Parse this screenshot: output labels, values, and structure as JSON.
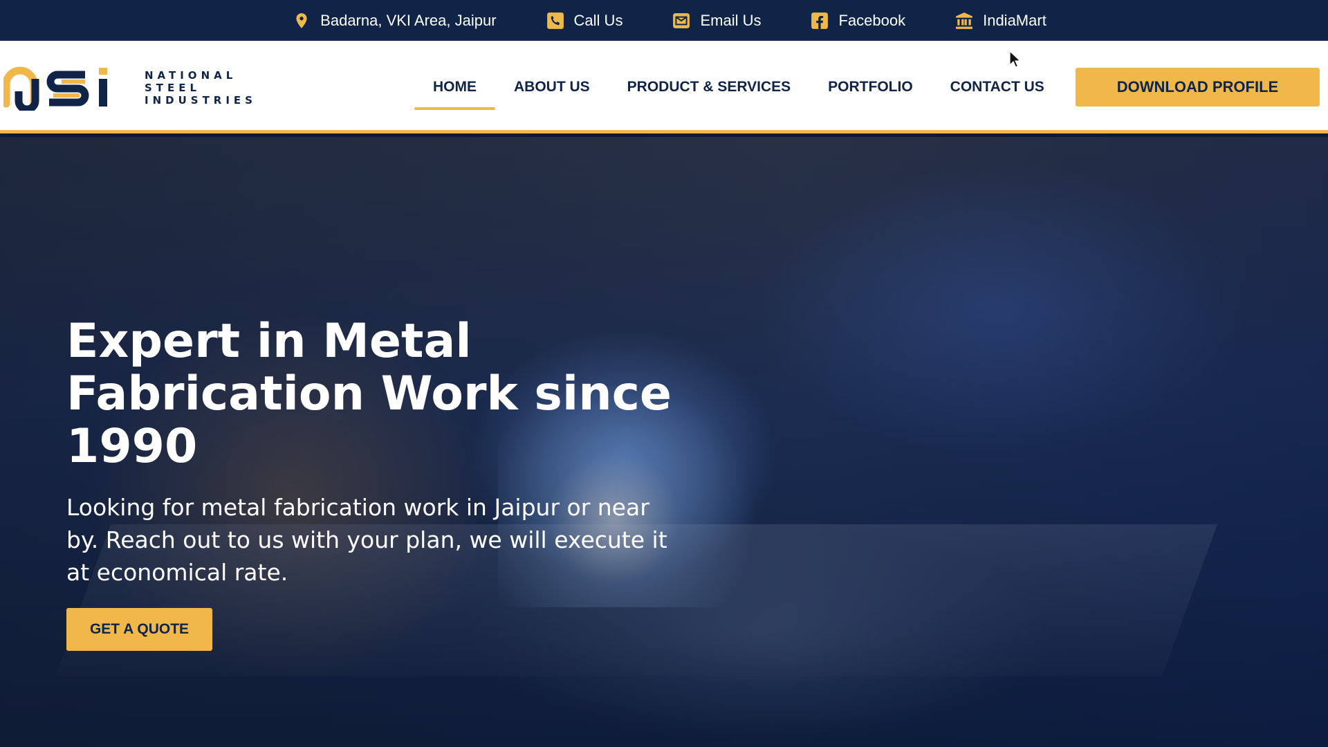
{
  "topbar": {
    "items": [
      {
        "icon": "map-pin-icon",
        "label": "Badarna, VKI Area, Jaipur"
      },
      {
        "icon": "phone-icon",
        "label": "Call Us"
      },
      {
        "icon": "mail-icon",
        "label": "Email Us"
      },
      {
        "icon": "facebook-icon",
        "label": "Facebook"
      },
      {
        "icon": "bank-icon",
        "label": "IndiaMart"
      }
    ]
  },
  "logo": {
    "line1": "NATIONAL",
    "line2": "STEEL",
    "line3": "INDUSTRIES"
  },
  "nav": {
    "items": [
      {
        "label": "HOME",
        "active": true
      },
      {
        "label": "ABOUT US"
      },
      {
        "label": "PRODUCT & SERVICES"
      },
      {
        "label": "PORTFOLIO"
      },
      {
        "label": "CONTACT US"
      }
    ],
    "download_label": "DOWNLOAD PROFILE"
  },
  "hero": {
    "title": "Expert in Metal Fabrication Work since 1990",
    "subtitle": "Looking for metal fabrication work in Jaipur or near by. Reach out to us with your plan, we will execute it at economical rate.",
    "cta_label": "GET A QUOTE"
  },
  "colors": {
    "navy": "#0f2447",
    "accent": "#f0b84b",
    "white": "#ffffff"
  }
}
